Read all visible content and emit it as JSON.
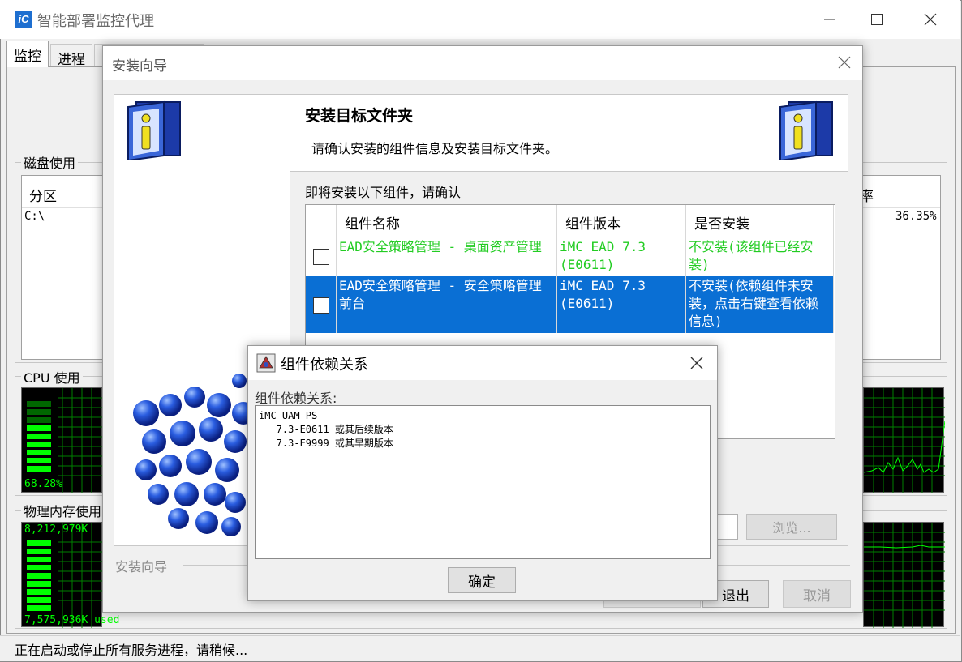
{
  "main_window": {
    "title": "智能部署监控代理",
    "tabs": [
      {
        "label": "监控"
      },
      {
        "label": "进程"
      }
    ],
    "disk": {
      "group_label": "磁盘使用",
      "col_partition": "分区",
      "col_rate": "率",
      "row_partition": "C:\\",
      "row_rate": "36.35%"
    },
    "cpu": {
      "group_label": "CPU 使用",
      "percent": "68.28%"
    },
    "memory": {
      "group_label": "物理内存使用",
      "total": "8,212,979K",
      "used": "7,575,936K used"
    },
    "status": "正在启动或停止所有服务进程，请稍候..."
  },
  "wizard": {
    "title": "安装向导",
    "header_title": "安装目标文件夹",
    "header_subtitle": "请确认安装的组件信息及安装目标文件夹。",
    "confirm_label": "即将安装以下组件，请确认",
    "columns": {
      "name": "组件名称",
      "version": "组件版本",
      "install": "是否安装"
    },
    "rows": [
      {
        "name": "EAD安全策略管理 - 桌面资产管理",
        "version": "iMC EAD 7.3 (E0611)",
        "install": "不安装(该组件已经安装)",
        "selected": false
      },
      {
        "name": "EAD安全策略管理 - 安全策略管理前台",
        "version": "iMC EAD 7.3 (E0611)",
        "install": "不安装(依赖组件未安装，点击右键查看依赖信息)",
        "selected": true
      }
    ],
    "browse_label": "浏览...",
    "footer_label": "安装向导",
    "exit_label": "退出",
    "cancel_label": "取消"
  },
  "dependency_dialog": {
    "title": "组件依赖关系",
    "label": "组件依赖关系:",
    "content": "iMC-UAM-PS\n   7.3-E0611 或其后续版本\n   7.3-E9999 或其早期版本",
    "ok_label": "确定"
  },
  "colors": {
    "selection": "#0a6fd4",
    "installed_green": "#22cc22",
    "scope_green": "#00ff00"
  }
}
